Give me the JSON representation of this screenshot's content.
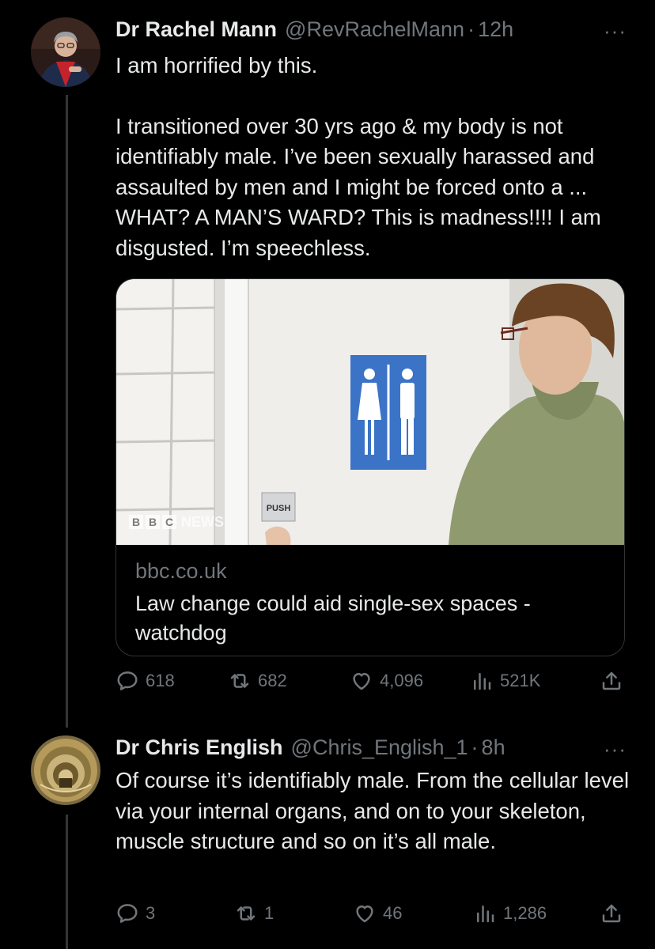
{
  "tweet1": {
    "name": "Dr Rachel Mann",
    "handle": "@RevRachelMann",
    "separator": "·",
    "time": "12h",
    "more": "···",
    "text_p1": "I am horrified by this.",
    "text_p2": "I transitioned over 30 yrs ago & my body is not identifiably male. I’ve been sexually harassed and assaulted by men and I might be forced onto a ... WHAT? A MAN’S WARD? This is madness!!!! I am disgusted. I’m speechless.",
    "card": {
      "image_push_label": "PUSH",
      "watermark": "BBC NEWS",
      "watermark_letters": [
        "B",
        "B",
        "C"
      ],
      "watermark_word": "NEWS",
      "domain": "bbc.co.uk",
      "title": "Law change could aid single-sex spaces - watchdog"
    },
    "stats": {
      "replies": "618",
      "reposts": "682",
      "likes": "4,096",
      "views": "521K"
    }
  },
  "tweet2": {
    "name": "Dr Chris English",
    "handle": "@Chris_English_1",
    "separator": "·",
    "time": "8h",
    "more": "···",
    "text": "Of course it’s identifiably male. From the cellular level via your internal organs, and on to your skeleton, muscle structure and so on it’s all male.",
    "stats": {
      "replies": "3",
      "reposts": "1",
      "likes": "46",
      "views": "1,286"
    }
  },
  "icons": [
    "reply-icon",
    "repost-icon",
    "like-icon",
    "views-icon",
    "share-icon",
    "more-icon"
  ],
  "colors": {
    "background": "#000000",
    "text": "#e7e9ea",
    "secondary": "#71767b",
    "border": "#2f3336",
    "toilet_sign": "#3b73c6"
  }
}
